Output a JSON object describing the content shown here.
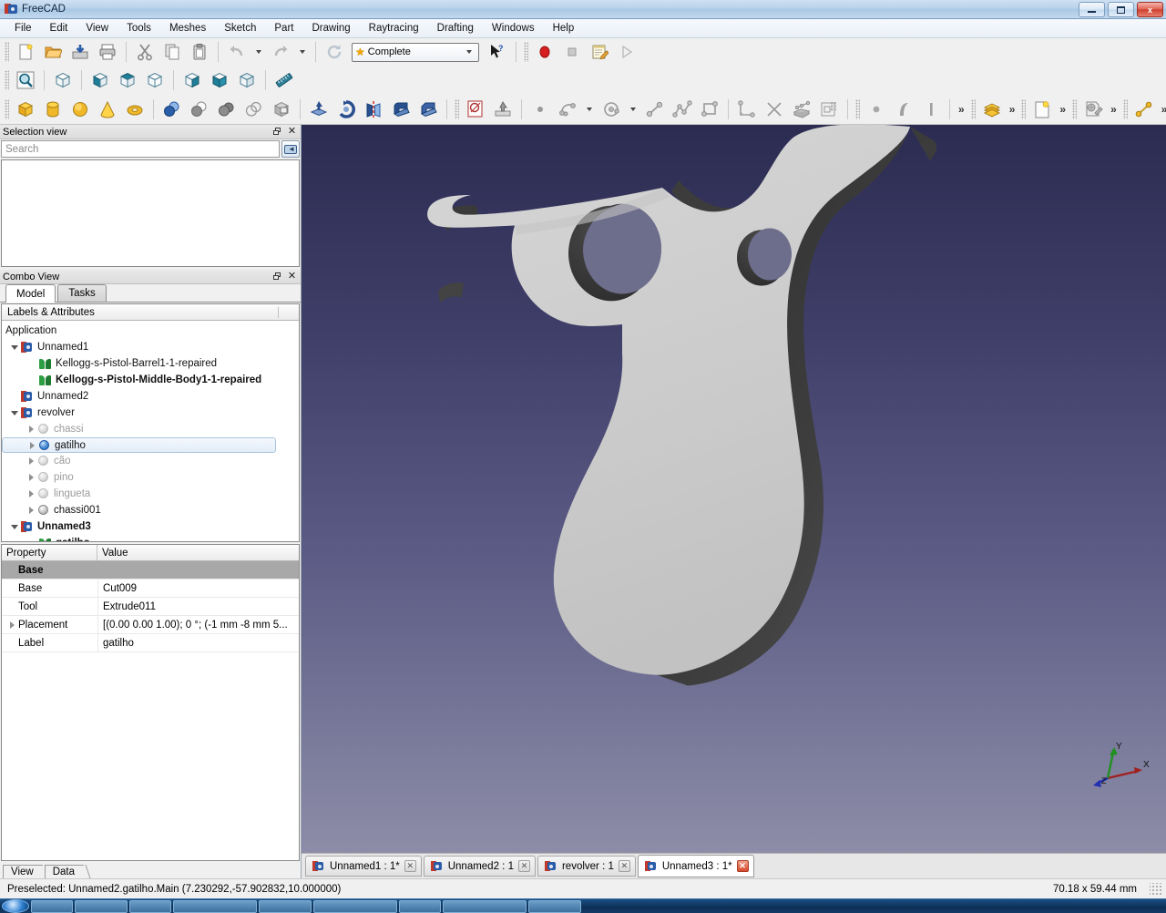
{
  "window": {
    "title": "FreeCAD",
    "minimize_label": "Minimize",
    "maximize_label": "Maximize",
    "close_label": "x"
  },
  "menubar": [
    {
      "label": "File"
    },
    {
      "label": "Edit"
    },
    {
      "label": "View"
    },
    {
      "label": "Tools"
    },
    {
      "label": "Meshes"
    },
    {
      "label": "Sketch"
    },
    {
      "label": "Part"
    },
    {
      "label": "Drawing"
    },
    {
      "label": "Raytracing"
    },
    {
      "label": "Drafting"
    },
    {
      "label": "Windows"
    },
    {
      "label": "Help"
    }
  ],
  "toolbars": {
    "file": [
      {
        "name": "new-document-button",
        "icon": "new-file-icon"
      },
      {
        "name": "open-document-button",
        "icon": "open-folder-icon"
      },
      {
        "name": "save-document-button",
        "icon": "save-icon"
      },
      {
        "name": "print-button",
        "icon": "printer-icon"
      },
      {
        "name": "cut-button",
        "icon": "scissors-icon"
      },
      {
        "name": "copy-button",
        "icon": "copy-icon"
      },
      {
        "name": "paste-button",
        "icon": "clipboard-icon"
      },
      {
        "name": "undo-button",
        "icon": "undo-arrow-icon"
      },
      {
        "name": "redo-button",
        "icon": "redo-arrow-icon"
      },
      {
        "name": "refresh-button",
        "icon": "refresh-icon"
      }
    ],
    "workbench": {
      "label": "Complete",
      "star_icon": "star-icon",
      "dropdown_icon": "chevron-down-icon"
    },
    "whats_this": {
      "name": "whats-this-button",
      "icon": "cursor-question-icon"
    },
    "macro": [
      {
        "name": "macro-record-button",
        "icon": "record-circle-icon"
      },
      {
        "name": "macro-stop-button",
        "icon": "stop-square-icon"
      },
      {
        "name": "macro-edit-button",
        "icon": "macro-edit-icon"
      },
      {
        "name": "macro-execute-button",
        "icon": "play-triangle-icon"
      }
    ],
    "view": [
      {
        "name": "fit-all-button",
        "icon": "magnifier-fit-icon"
      },
      {
        "name": "axonometric-view-button",
        "icon": "cube-axonometric-icon"
      },
      {
        "name": "front-view-button",
        "icon": "cube-front-icon"
      },
      {
        "name": "top-view-button",
        "icon": "cube-top-icon"
      },
      {
        "name": "right-view-button",
        "icon": "cube-right-icon"
      },
      {
        "name": "rear-view-button",
        "icon": "cube-rear-icon"
      },
      {
        "name": "bottom-view-button",
        "icon": "cube-bottom-icon"
      },
      {
        "name": "left-view-button",
        "icon": "cube-left-icon"
      },
      {
        "name": "measure-button",
        "icon": "ruler-icon"
      }
    ],
    "part": [
      {
        "name": "part-box-button",
        "icon": "yellow-box-icon"
      },
      {
        "name": "part-cylinder-button",
        "icon": "yellow-cylinder-icon"
      },
      {
        "name": "part-sphere-button",
        "icon": "yellow-sphere-icon"
      },
      {
        "name": "part-cone-button",
        "icon": "yellow-cone-icon"
      },
      {
        "name": "part-torus-button",
        "icon": "yellow-torus-icon"
      },
      {
        "name": "boolean-button",
        "icon": "two-spheres-blue-icon"
      },
      {
        "name": "union-button",
        "icon": "union-icon"
      },
      {
        "name": "common-button",
        "icon": "common-icon"
      },
      {
        "name": "cut-shape-button",
        "icon": "cut-shape-icon"
      },
      {
        "name": "section-button",
        "icon": "section-box-icon"
      },
      {
        "name": "extrude-button",
        "icon": "extrude-icon"
      },
      {
        "name": "revolve-button",
        "icon": "revolve-icon"
      },
      {
        "name": "mirror-button",
        "icon": "mirror-icon"
      },
      {
        "name": "fillet-button",
        "icon": "fillet-icon"
      },
      {
        "name": "chamfer-button",
        "icon": "chamfer-icon"
      }
    ],
    "sketch": [
      {
        "name": "new-sketch-button",
        "icon": "new-sketch-icon"
      },
      {
        "name": "leave-sketch-button",
        "icon": "leave-sketch-icon"
      },
      {
        "name": "sketch-point-button",
        "icon": "point-icon"
      },
      {
        "name": "sketch-arc-button",
        "icon": "arc-icon"
      },
      {
        "name": "sketch-circle-button",
        "icon": "circle-icon"
      },
      {
        "name": "sketch-line-button",
        "icon": "line-icon"
      },
      {
        "name": "sketch-polyline-button",
        "icon": "polyline-icon"
      },
      {
        "name": "sketch-rectangle-button",
        "icon": "rectangle-icon"
      },
      {
        "name": "constrain-button",
        "icon": "constraint-icon"
      },
      {
        "name": "trim-button",
        "icon": "trim-icon"
      },
      {
        "name": "map-sketch-button",
        "icon": "map-sketch-icon"
      },
      {
        "name": "sketch-array-button",
        "icon": "array-icon"
      }
    ],
    "draft": [
      {
        "name": "draft-point-button",
        "icon": "draft-point-icon"
      },
      {
        "name": "draft-bspline-button",
        "icon": "draft-bspline-icon"
      },
      {
        "name": "draft-line-button",
        "icon": "draft-line-icon"
      }
    ],
    "overflow": [
      {
        "name": "toolbar-overflow-1",
        "icon": "double-chevron-icon"
      },
      {
        "name": "mesh-workbench-button",
        "icon": "yellow-book-icon"
      },
      {
        "name": "toolbar-overflow-2",
        "icon": "double-chevron-icon"
      },
      {
        "name": "drawing-page-button",
        "icon": "page-icon"
      },
      {
        "name": "toolbar-overflow-3",
        "icon": "double-chevron-icon"
      },
      {
        "name": "raytracing-button",
        "icon": "raytracing-icon"
      },
      {
        "name": "toolbar-overflow-4",
        "icon": "double-chevron-icon"
      },
      {
        "name": "drafting-line-button",
        "icon": "draft-wire-icon"
      },
      {
        "name": "toolbar-overflow-5",
        "icon": "double-chevron-icon"
      }
    ]
  },
  "selection_view": {
    "title": "Selection view",
    "search_placeholder": "Search",
    "clear_icon": "backspace-clear-icon",
    "float_icon": "float-window-icon",
    "close_icon": "close-icon",
    "items": []
  },
  "combo_view": {
    "title": "Combo View",
    "float_icon": "float-window-icon",
    "close_icon": "close-icon",
    "tabs": [
      {
        "label": "Model",
        "active": true
      },
      {
        "label": "Tasks",
        "active": false
      }
    ],
    "tree_header": "Labels & Attributes",
    "tree": [
      {
        "label": "Application",
        "depth": 0,
        "icon": "none",
        "expander": "none",
        "style": "normal"
      },
      {
        "label": "Unnamed1",
        "depth": 1,
        "icon": "document",
        "expander": "open",
        "style": "normal"
      },
      {
        "label": "Kellogg-s-Pistol-Barrel1-1-repaired",
        "depth": 2,
        "icon": "mesh",
        "expander": "none",
        "style": "normal"
      },
      {
        "label": "Kellogg-s-Pistol-Middle-Body1-1-repaired",
        "depth": 2,
        "icon": "mesh",
        "expander": "none",
        "style": "bold"
      },
      {
        "label": "Unnamed2",
        "depth": 1,
        "icon": "document",
        "expander": "none",
        "style": "normal"
      },
      {
        "label": "revolver",
        "depth": 1,
        "icon": "document",
        "expander": "open",
        "style": "normal"
      },
      {
        "label": "chassi",
        "depth": 2,
        "icon": "solid-dim",
        "expander": "closed",
        "style": "dim"
      },
      {
        "label": "gatilho",
        "depth": 2,
        "icon": "solid-blue",
        "expander": "closed",
        "style": "normal",
        "selected": true
      },
      {
        "label": "cão",
        "depth": 2,
        "icon": "solid-dim",
        "expander": "closed",
        "style": "dim"
      },
      {
        "label": "pino",
        "depth": 2,
        "icon": "solid-dim",
        "expander": "closed",
        "style": "dim"
      },
      {
        "label": "lingueta",
        "depth": 2,
        "icon": "solid-dim",
        "expander": "closed",
        "style": "dim"
      },
      {
        "label": "chassi001",
        "depth": 2,
        "icon": "solid",
        "expander": "closed",
        "style": "normal"
      },
      {
        "label": "Unnamed3",
        "depth": 1,
        "icon": "document",
        "expander": "open",
        "style": "bold"
      },
      {
        "label": "gatilho",
        "depth": 2,
        "icon": "mesh",
        "expander": "none",
        "style": "bold"
      }
    ]
  },
  "property_editor": {
    "headers": {
      "property": "Property",
      "value": "Value"
    },
    "rows": [
      {
        "name": "Base",
        "value": "",
        "group": true
      },
      {
        "name": "Base",
        "value": "Cut009",
        "group": false
      },
      {
        "name": "Tool",
        "value": "Extrude011",
        "group": false
      },
      {
        "name": "Placement",
        "value": "[(0.00 0.00 1.00); 0 °; (-1 mm  -8 mm  5...",
        "group": false,
        "expandable": true
      },
      {
        "name": "Label",
        "value": "gatilho",
        "group": false
      }
    ],
    "bottom_tabs": [
      {
        "label": "View",
        "active": false
      },
      {
        "label": "Data",
        "active": true
      }
    ]
  },
  "document_tabs": [
    {
      "label": "Unnamed1 : 1*",
      "active": false,
      "icon": "freecad-doc-icon",
      "close_icon": "close-icon"
    },
    {
      "label": "Unnamed2 : 1",
      "active": false,
      "icon": "freecad-doc-icon",
      "close_icon": "close-icon"
    },
    {
      "label": "revolver : 1",
      "active": false,
      "icon": "freecad-doc-icon",
      "close_icon": "close-icon"
    },
    {
      "label": "Unnamed3 : 1*",
      "active": true,
      "icon": "freecad-doc-icon",
      "close_icon": "close-icon"
    }
  ],
  "view3d": {
    "axis": {
      "x_label": "X",
      "y_label": "Y",
      "z_label": "Z",
      "x_color": "#a02020",
      "y_color": "#1f9020",
      "z_color": "#2030b0"
    },
    "model_name": "gatilho",
    "face_color": "#cfcfcf",
    "edge_color": "#3a3a3a",
    "background_top": "#2c2c52",
    "background_bottom": "#8d8da8"
  },
  "statusbar": {
    "message": "Preselected: Unnamed2.gatilho.Main (7.230292,-57.902832,10.000000)",
    "dimensions": "70.18 x 59.44 mm"
  },
  "taskbar": {
    "start_icon": "windows-start-orb"
  }
}
